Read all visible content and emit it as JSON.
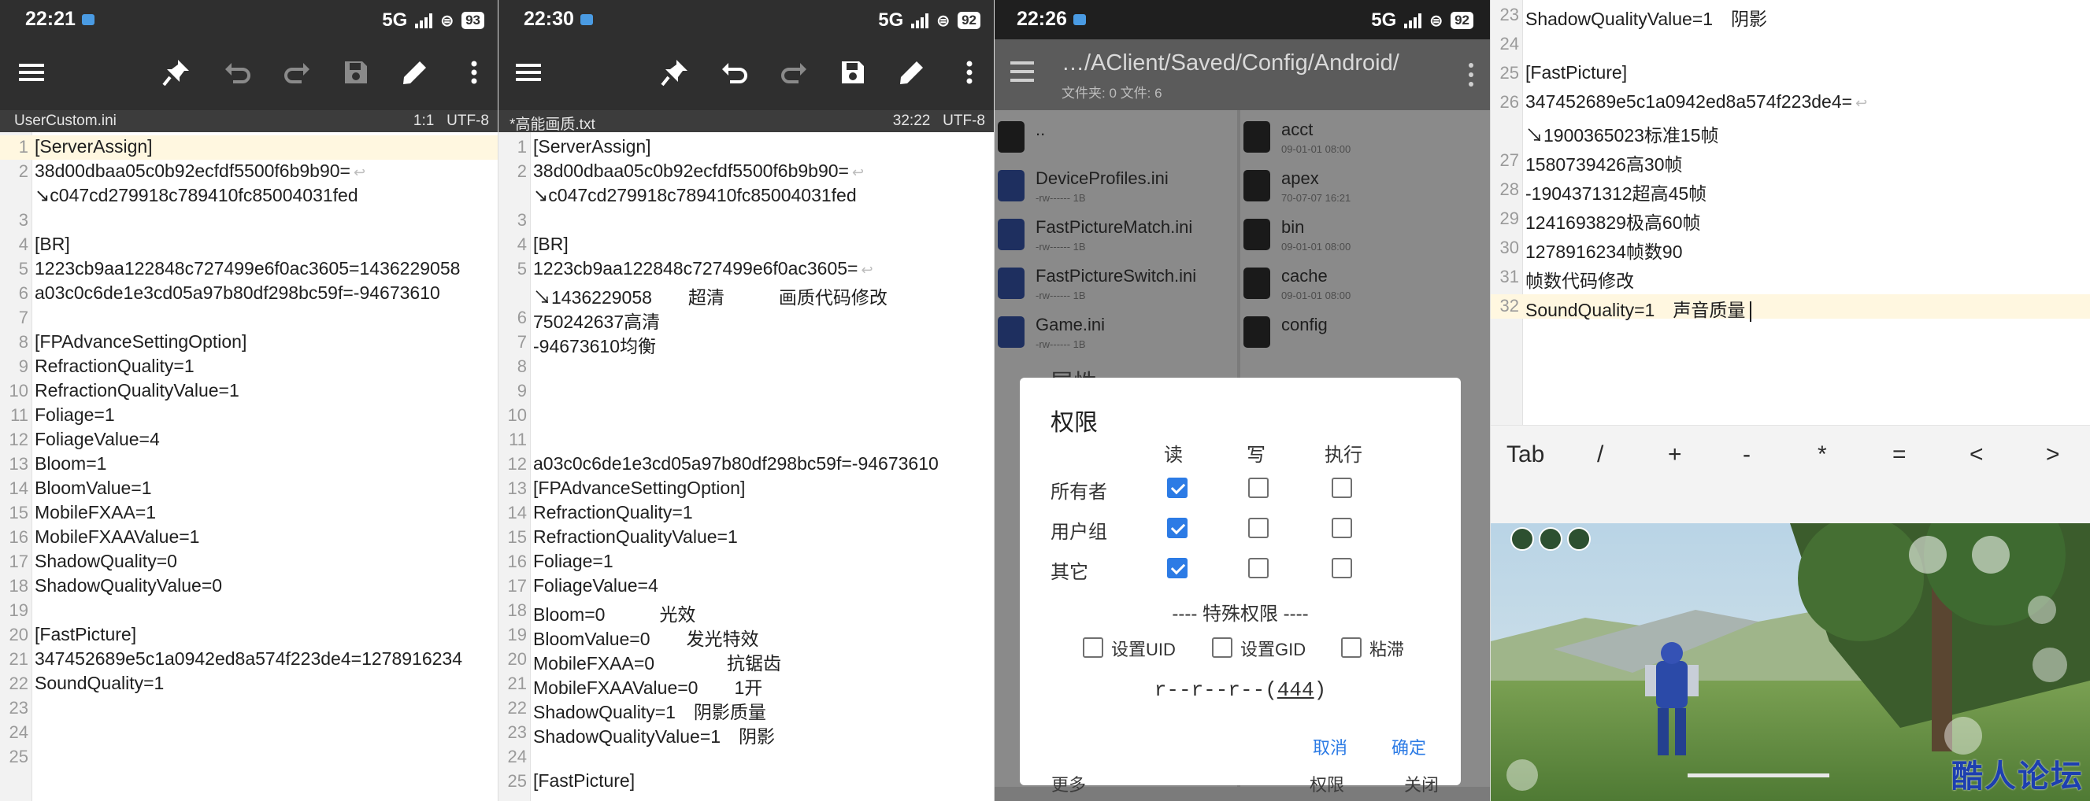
{
  "panel1": {
    "status": {
      "time": "22:21",
      "network": "5G",
      "battery": "93"
    },
    "file": {
      "name": "UserCustom.ini",
      "position": "1:1",
      "encoding": "UTF-8"
    },
    "lines": [
      {
        "n": "1",
        "t": "[ServerAssign]"
      },
      {
        "n": "2",
        "t": "38d00dbaa05c0b92ecfdf5500f6b9b90=",
        "c": "↩"
      },
      {
        "n": "",
        "t": "↘c047cd279918c789410fc85004031fed"
      },
      {
        "n": "3",
        "t": ""
      },
      {
        "n": "4",
        "t": "[BR]"
      },
      {
        "n": "5",
        "t": "1223cb9aa122848c727499e6f0ac3605=1436229058"
      },
      {
        "n": "6",
        "t": "a03c0c6de1e3cd05a97b80df298bc59f=-94673610"
      },
      {
        "n": "7",
        "t": ""
      },
      {
        "n": "8",
        "t": "[FPAdvanceSettingOption]"
      },
      {
        "n": "9",
        "t": "RefractionQuality=1"
      },
      {
        "n": "10",
        "t": "RefractionQualityValue=1"
      },
      {
        "n": "11",
        "t": "Foliage=1"
      },
      {
        "n": "12",
        "t": "FoliageValue=4"
      },
      {
        "n": "13",
        "t": "Bloom=1"
      },
      {
        "n": "14",
        "t": "BloomValue=1"
      },
      {
        "n": "15",
        "t": "MobileFXAA=1"
      },
      {
        "n": "16",
        "t": "MobileFXAAValue=1"
      },
      {
        "n": "17",
        "t": "ShadowQuality=0"
      },
      {
        "n": "18",
        "t": "ShadowQualityValue=0"
      },
      {
        "n": "19",
        "t": ""
      },
      {
        "n": "20",
        "t": "[FastPicture]"
      },
      {
        "n": "21",
        "t": "347452689e5c1a0942ed8a574f223de4=1278916234"
      },
      {
        "n": "22",
        "t": "SoundQuality=1"
      },
      {
        "n": "23",
        "t": ""
      },
      {
        "n": "24",
        "t": ""
      },
      {
        "n": "25",
        "t": ""
      }
    ]
  },
  "panel2": {
    "status": {
      "time": "22:30",
      "network": "5G",
      "battery": "92"
    },
    "file": {
      "name": "*高能画质.txt",
      "position": "32:22",
      "encoding": "UTF-8"
    },
    "lines": [
      {
        "n": "1",
        "t": "[ServerAssign]"
      },
      {
        "n": "2",
        "t": "38d00dbaa05c0b92ecfdf5500f6b9b90=",
        "c": "↩"
      },
      {
        "n": "",
        "t": "↘c047cd279918c789410fc85004031fed"
      },
      {
        "n": "3",
        "t": ""
      },
      {
        "n": "4",
        "t": "[BR]"
      },
      {
        "n": "5",
        "t": "1223cb9aa122848c727499e6f0ac3605=",
        "c": "↩"
      },
      {
        "n": "",
        "t": "↘1436229058　　超清　　　画质代码修改"
      },
      {
        "n": "6",
        "t": "750242637高清"
      },
      {
        "n": "7",
        "t": "-94673610均衡"
      },
      {
        "n": "8",
        "t": ""
      },
      {
        "n": "9",
        "t": ""
      },
      {
        "n": "10",
        "t": ""
      },
      {
        "n": "11",
        "t": ""
      },
      {
        "n": "12",
        "t": "a03c0c6de1e3cd05a97b80df298bc59f=-94673610"
      },
      {
        "n": "13",
        "t": "[FPAdvanceSettingOption]"
      },
      {
        "n": "14",
        "t": "RefractionQuality=1"
      },
      {
        "n": "15",
        "t": "RefractionQualityValue=1"
      },
      {
        "n": "16",
        "t": "Foliage=1"
      },
      {
        "n": "17",
        "t": "FoliageValue=4"
      },
      {
        "n": "18",
        "t": "Bloom=0　　　光效"
      },
      {
        "n": "19",
        "t": "BloomValue=0　　发光特效"
      },
      {
        "n": "20",
        "t": "MobileFXAA=0　　　　抗锯齿"
      },
      {
        "n": "21",
        "t": "MobileFXAAValue=0　　1开"
      },
      {
        "n": "22",
        "t": "ShadowQuality=1　阴影质量"
      },
      {
        "n": "23",
        "t": "ShadowQualityValue=1　阴影"
      },
      {
        "n": "24",
        "t": ""
      },
      {
        "n": "25",
        "t": "[FastPicture]"
      }
    ]
  },
  "panel3": {
    "status": {
      "time": "22:26",
      "network": "5G",
      "battery": "92"
    },
    "path": "…/AClient/Saved/Config/Android/",
    "counts": "文件夹: 0  文件: 6",
    "left_items": [
      {
        "name": "..",
        "meta": "",
        "kind": "folder"
      },
      {
        "name": "DeviceProfiles.ini",
        "meta": "-rw------  1B",
        "kind": "file"
      },
      {
        "name": "FastPictureMatch.ini",
        "meta": "-rw------  1B",
        "kind": "file"
      },
      {
        "name": "FastPictureSwitch.ini",
        "meta": "-rw------  1B",
        "kind": "file"
      },
      {
        "name": "Game.ini",
        "meta": "-rw------  1B",
        "kind": "file"
      }
    ],
    "right_items": [
      {
        "name": "acct",
        "meta": "09-01-01 08:00",
        "kind": "folder"
      },
      {
        "name": "apex",
        "meta": "70-07-07 16:21",
        "kind": "folder"
      },
      {
        "name": "bin",
        "meta": "09-01-01 08:00",
        "kind": "folder"
      },
      {
        "name": "cache",
        "meta": "09-01-01 08:00",
        "kind": "folder"
      },
      {
        "name": "config",
        "meta": "",
        "kind": "folder"
      }
    ],
    "behind_title": "属性",
    "dialog": {
      "title": "权限",
      "cols": [
        "读",
        "写",
        "执行"
      ],
      "rows": [
        {
          "label": "所有者",
          "checks": [
            true,
            false,
            false
          ]
        },
        {
          "label": "用户组",
          "checks": [
            true,
            false,
            false
          ]
        },
        {
          "label": "其它",
          "checks": [
            true,
            false,
            false
          ]
        }
      ],
      "special_title": "---- 特殊权限 ----",
      "special": [
        {
          "label": "设置UID",
          "checked": false
        },
        {
          "label": "设置GID",
          "checked": false
        },
        {
          "label": "粘滞",
          "checked": false
        }
      ],
      "perm_prefix": "r--r--r--(",
      "perm_code": "444",
      "perm_suffix": ")",
      "cancel": "取消",
      "ok": "确定"
    },
    "bottom_left": "更多",
    "bottom_mid": "权限",
    "bottom_right": "关闭"
  },
  "panel4": {
    "lines": [
      {
        "n": "23",
        "t": "ShadowQualityValue=1　阴影"
      },
      {
        "n": "24",
        "t": ""
      },
      {
        "n": "25",
        "t": "[FastPicture]"
      },
      {
        "n": "26",
        "t": "347452689e5c1a0942ed8a574f223de4=",
        "c": "↩"
      },
      {
        "n": "",
        "t": "↘1900365023标准15帧"
      },
      {
        "n": "27",
        "t": "1580739426高30帧"
      },
      {
        "n": "28",
        "t": "-1904371312超高45帧"
      },
      {
        "n": "29",
        "t": "1241693829极高60帧"
      },
      {
        "n": "30",
        "t": "1278916234帧数90"
      },
      {
        "n": "31",
        "t": "帧数代码修改"
      },
      {
        "n": "32",
        "t": "SoundQuality=1　声音质量"
      }
    ],
    "keys": [
      "Tab",
      "/",
      "+",
      "-",
      "*",
      "=",
      "<",
      ">"
    ],
    "watermark": "酷人论坛"
  }
}
